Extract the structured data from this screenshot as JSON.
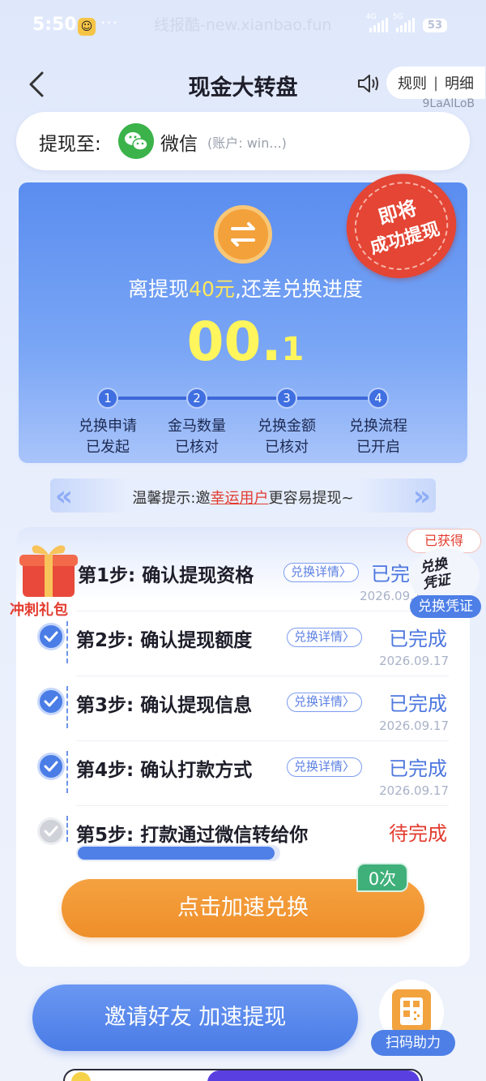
{
  "status_bar": {
    "time": "5:50",
    "watermark": "线报酷-new.xianbao.fun",
    "network_1": "4G",
    "network_2": "5G",
    "battery": "53"
  },
  "header": {
    "title": "现金大转盘",
    "rules_label": "规则",
    "separator": "|",
    "details_label": "明细",
    "user_id": "9LaAlLoB"
  },
  "withdraw": {
    "label": "提现至:",
    "method": "微信",
    "account": "(账户: win...)"
  },
  "progress_card": {
    "headline_prefix": "离提现",
    "amount": "40元",
    "headline_suffix": ",还差兑换进度",
    "progress_main": "00.",
    "progress_decimal": "1",
    "stamp_line1": "即将",
    "stamp_line2": "成功提现",
    "steps": [
      {
        "num": "1",
        "line1": "兑换申请",
        "line2": "已发起"
      },
      {
        "num": "2",
        "line1": "金马数量",
        "line2": "已核对"
      },
      {
        "num": "3",
        "line1": "兑换金额",
        "line2": "已核对"
      },
      {
        "num": "4",
        "line1": "兑换流程",
        "line2": "已开启"
      }
    ]
  },
  "tip": {
    "prefix": "温馨提示:邀",
    "highlight": "幸运用户",
    "suffix": "更容易提现~"
  },
  "gift": {
    "label": "冲刺礼包"
  },
  "voucher": {
    "got_label": "已获得",
    "stamp_text_1": "兑换",
    "stamp_text_2": "凭证",
    "badge": "兑换凭证"
  },
  "steps_list": [
    {
      "title": "第1步: 确认提现资格",
      "detail": "兑换详情〉",
      "status": "已完成",
      "date": "2026.09.17",
      "done": true
    },
    {
      "title": "第2步: 确认提现额度",
      "detail": "兑换详情〉",
      "status": "已完成",
      "date": "2026.09.17",
      "done": true
    },
    {
      "title": "第3步: 确认提现信息",
      "detail": "兑换详情〉",
      "status": "已完成",
      "date": "2026.09.17",
      "done": true
    },
    {
      "title": "第4步: 确认打款方式",
      "detail": "兑换详情〉",
      "status": "已完成",
      "date": "2026.09.17",
      "done": true
    },
    {
      "title": "第5步: 打款通过微信转给你",
      "status": "待完成",
      "done": false
    }
  ],
  "step5_progress": 0.98,
  "accelerate": {
    "label": "点击加速兑换",
    "count": "0次"
  },
  "invite": {
    "label": "邀请好友 加速提现",
    "scan_label": "扫码助力"
  },
  "colors": {
    "primary_blue": "#4a7de6",
    "orange": "#f29a36",
    "red": "#e33b2e",
    "yellow": "#fff55c"
  }
}
